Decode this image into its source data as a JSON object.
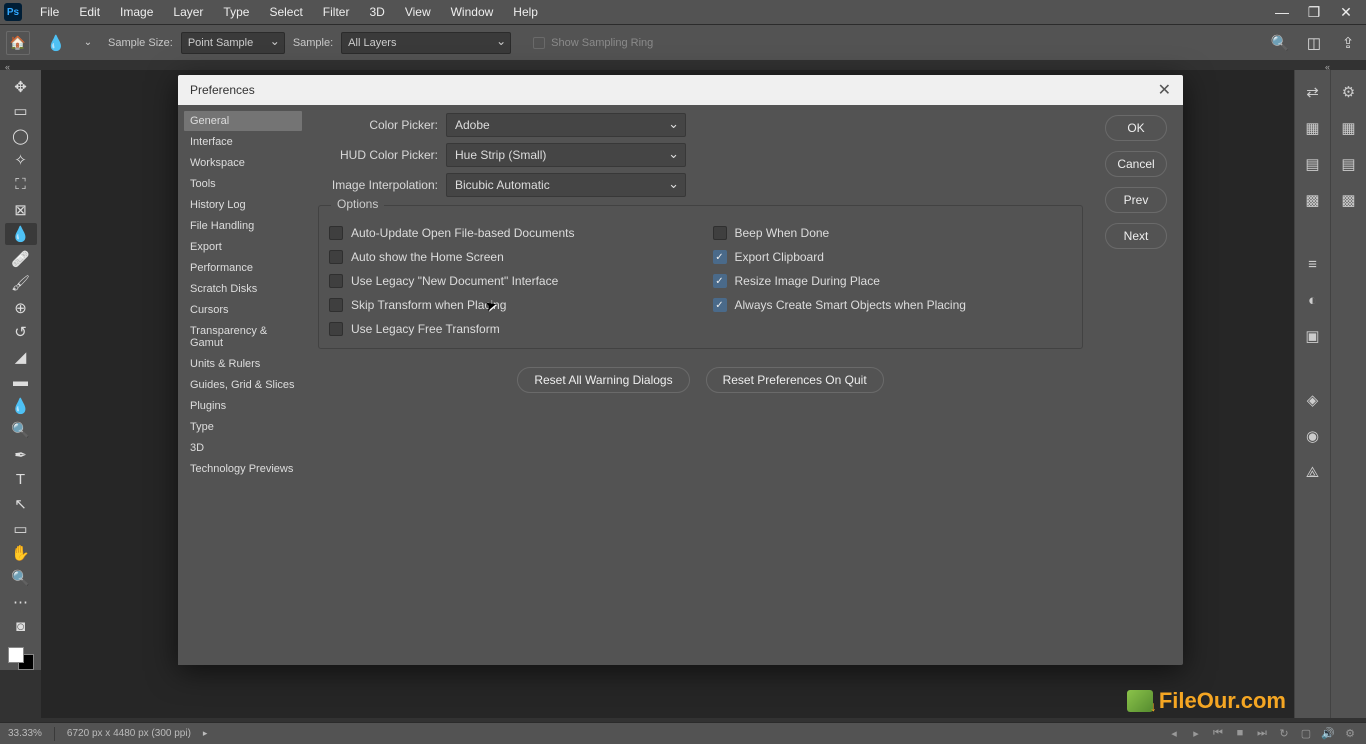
{
  "menubar": {
    "items": [
      "File",
      "Edit",
      "Image",
      "Layer",
      "Type",
      "Select",
      "Filter",
      "3D",
      "View",
      "Window",
      "Help"
    ]
  },
  "optbar": {
    "sample_size_label": "Sample Size:",
    "sample_size_value": "Point Sample",
    "sample_label": "Sample:",
    "sample_value": "All Layers",
    "show_ring": "Show Sampling Ring"
  },
  "dialog": {
    "title": "Preferences",
    "side_items": [
      "General",
      "Interface",
      "Workspace",
      "Tools",
      "History Log",
      "File Handling",
      "Export",
      "Performance",
      "Scratch Disks",
      "Cursors",
      "Transparency & Gamut",
      "Units & Rulers",
      "Guides, Grid & Slices",
      "Plugins",
      "Type",
      "3D",
      "Technology Previews"
    ],
    "side_active_index": 0,
    "rows": {
      "color_picker_label": "Color Picker:",
      "color_picker_value": "Adobe",
      "hud_label": "HUD Color Picker:",
      "hud_value": "Hue Strip (Small)",
      "interp_label": "Image Interpolation:",
      "interp_value": "Bicubic Automatic"
    },
    "options_legend": "Options",
    "opts_left": [
      {
        "label": "Auto-Update Open File-based Documents",
        "checked": false
      },
      {
        "label": "Auto show the Home Screen",
        "checked": false
      },
      {
        "label": "Use Legacy \"New Document\" Interface",
        "checked": false
      },
      {
        "label": "Skip Transform when Placing",
        "checked": false
      },
      {
        "label": "Use Legacy Free Transform",
        "checked": false
      }
    ],
    "opts_right": [
      {
        "label": "Beep When Done",
        "checked": false
      },
      {
        "label": "Export Clipboard",
        "checked": true
      },
      {
        "label": "Resize Image During Place",
        "checked": true
      },
      {
        "label": "Always Create Smart Objects when Placing",
        "checked": true
      }
    ],
    "reset_warnings": "Reset All Warning Dialogs",
    "reset_prefs": "Reset Preferences On Quit",
    "ok": "OK",
    "cancel": "Cancel",
    "prev": "Prev",
    "next": "Next"
  },
  "status": {
    "zoom": "33.33%",
    "docinfo": "6720 px x 4480 px (300 ppi)"
  },
  "watermark": "FileOur.com"
}
